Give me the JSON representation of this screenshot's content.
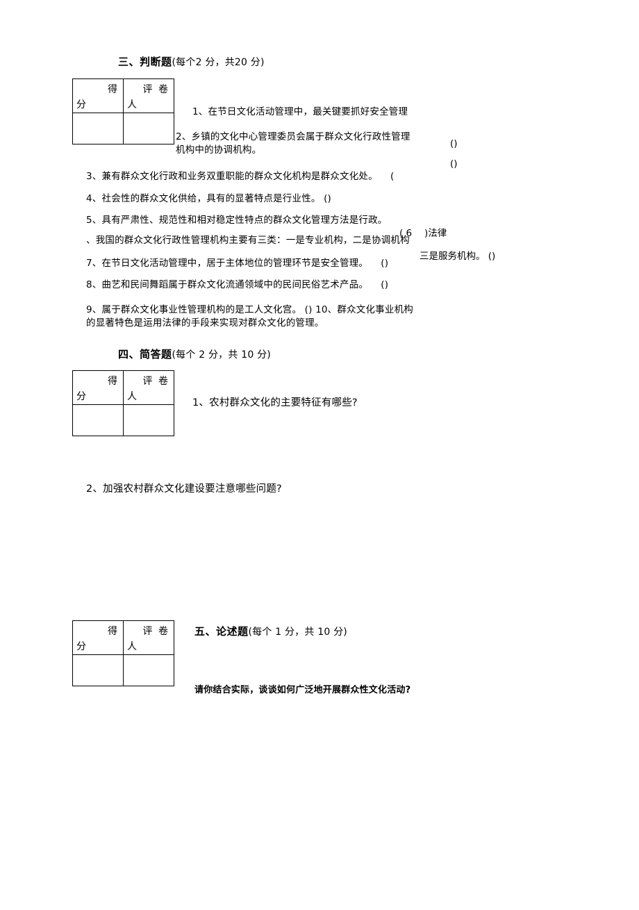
{
  "document": {
    "type": "exam-paper",
    "language": "zh"
  },
  "score_table": {
    "label_score_top": "得",
    "label_score_bottom": "分",
    "label_grader_top": "评 卷",
    "label_grader_bottom": "人"
  },
  "sections": [
    {
      "id": "section-three",
      "title": "三、判断题",
      "note": "(每个2 分，共20 分)"
    },
    {
      "id": "section-four",
      "title": "四、简答题",
      "note": "(每个 2 分，共 10 分)"
    },
    {
      "id": "section-five",
      "title": "五、论述题",
      "note": "(每个 1 分，共 10 分)"
    }
  ],
  "true_false_questions": [
    {
      "number": "1",
      "text": "1、在节日文化活动管理中，最关键要抓好安全管理"
    },
    {
      "number": "2",
      "text": "2、乡镇的文化中心管理委员会属于群众文化行政性管理机构中的协调机构。"
    },
    {
      "number": "3",
      "text": "3、兼有群众文化行政和业务双重职能的群众文化机构是群众文化处。 　("
    },
    {
      "number": "4",
      "text": "4、社会性的群众文化供给，具有的显著特点是行业性。 ()"
    },
    {
      "number": "5",
      "text": "5、具有严肃性、规范性和相对稳定性特点的群众文化管理方法是行政。"
    },
    {
      "number": "6",
      "text": "、我国的群众文化行政性管理机构主要有三类：一是专业机构，二是协调机构"
    },
    {
      "number": "7",
      "text": "7、在节日文化活动管理中，居于主体地位的管理环节是安全管理。 　()"
    },
    {
      "number": "8",
      "text": "8、曲艺和民间舞蹈属于群众文化流通领域中的民间民俗艺术产品。 　()"
    },
    {
      "number": "9",
      "text": "9、属于群众文化事业性管理机构的是工人文化宫。 () 10、群众文化事业机构的显著特色是运用法律的手段来实现对群众文化的管理。"
    }
  ],
  "floating_marks": [
    {
      "id": "mark-q2-paren",
      "text": "()"
    },
    {
      "id": "mark-q3-paren",
      "text": "()"
    },
    {
      "id": "mark-q5-answer",
      "text": "( 6 　)法律"
    },
    {
      "id": "mark-q6-answer",
      "text": "三是服务机构。 ()"
    }
  ],
  "short_answer_questions": [
    {
      "number": "1",
      "text": "1、农村群众文化的主要特征有哪些?"
    },
    {
      "number": "2",
      "text": "2、加强农村群众文化建设要注意哪些问题?"
    }
  ],
  "essay_question": {
    "text": "请你结合实际，谈谈如何广泛地开展群众性文化活动?"
  }
}
